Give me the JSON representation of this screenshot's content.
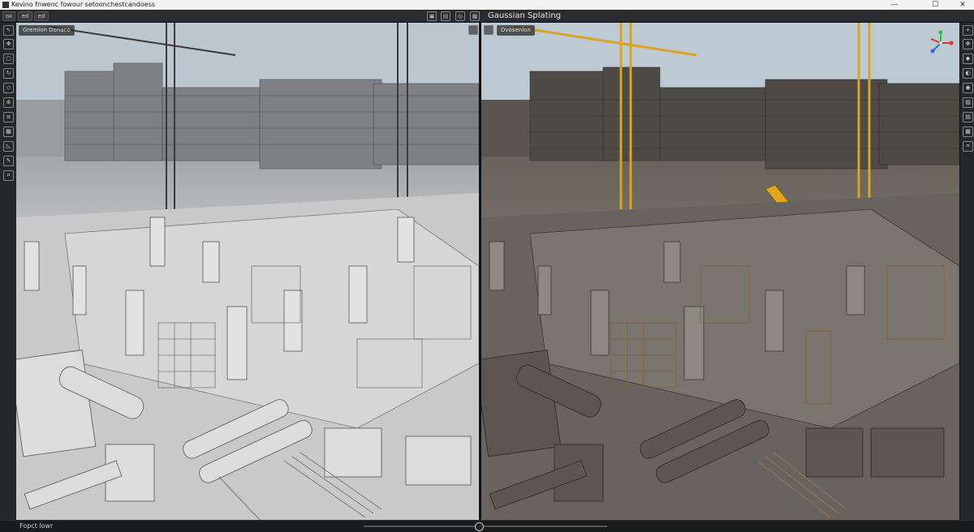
{
  "window": {
    "title": "Kevino fnwenc fowour setoonchestcandoess",
    "minimize": "—",
    "maximize": "☐",
    "close": "✕"
  },
  "menubar": {
    "buttons": [
      "ox",
      "ed",
      "ed"
    ],
    "view_title": "Gaussian Splating"
  },
  "viewports": {
    "left_label": "Gremlon Donaco",
    "right_label": "Dvosenlon"
  },
  "status": {
    "text": "Fopct lowr"
  },
  "colors": {
    "crane_yellow": "#d9a324",
    "excavator_yellow": "#e0a61f",
    "gizmo_x": "#e03030",
    "gizmo_y": "#30c040",
    "gizmo_z": "#3070e0"
  }
}
